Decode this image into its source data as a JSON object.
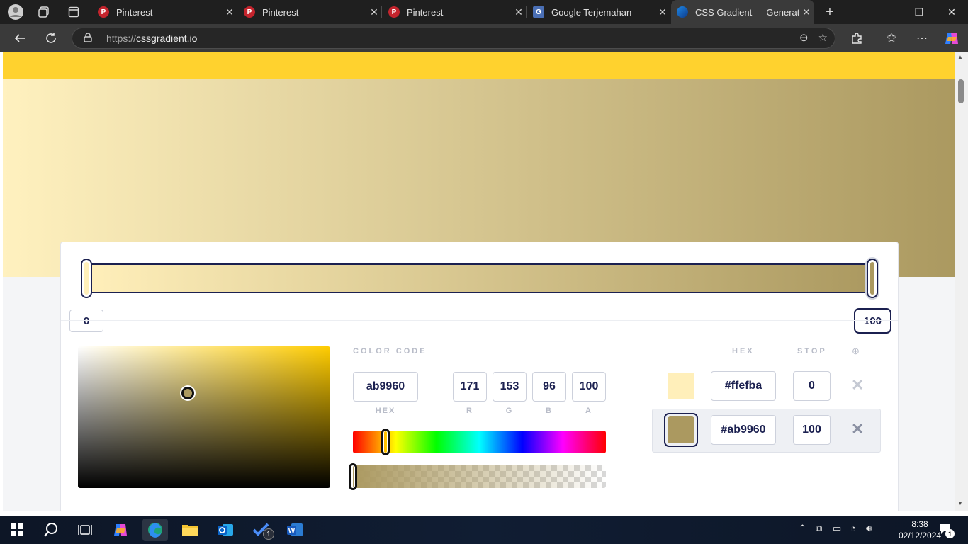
{
  "browser": {
    "tabs": [
      {
        "title": "Pinterest",
        "icon": "pinterest-icon"
      },
      {
        "title": "Pinterest",
        "icon": "pinterest-icon"
      },
      {
        "title": "Pinterest",
        "icon": "pinterest-icon"
      },
      {
        "title": "Google Terjemahan",
        "icon": "google-translate-icon"
      },
      {
        "title": "CSS Gradient — Generator",
        "icon": "cssgradient-icon",
        "active": true
      }
    ],
    "url_prefix": "https://",
    "url_host": "cssgradient.io"
  },
  "gradient": {
    "start_color": "#ffefba",
    "end_color": "#ab9960",
    "stop_left": "0",
    "stop_right": "100"
  },
  "picker": {
    "color_code_label": "COLOR CODE",
    "hex_value": "ab9960",
    "hex_label": "HEX",
    "r": "171",
    "g": "153",
    "b": "96",
    "a": "100",
    "r_label": "R",
    "g_label": "G",
    "b_label": "B",
    "a_label": "A"
  },
  "stops_panel": {
    "hex_header": "HEX",
    "stop_header": "STOP",
    "rows": [
      {
        "hex": "#ffefba",
        "stop": "0",
        "color": "#ffefba"
      },
      {
        "hex": "#ab9960",
        "stop": "100",
        "color": "#ab9960"
      }
    ]
  },
  "taskbar": {
    "time": "8:38",
    "date": "02/12/2024",
    "notif_count": "1",
    "todo_badge": "1"
  }
}
